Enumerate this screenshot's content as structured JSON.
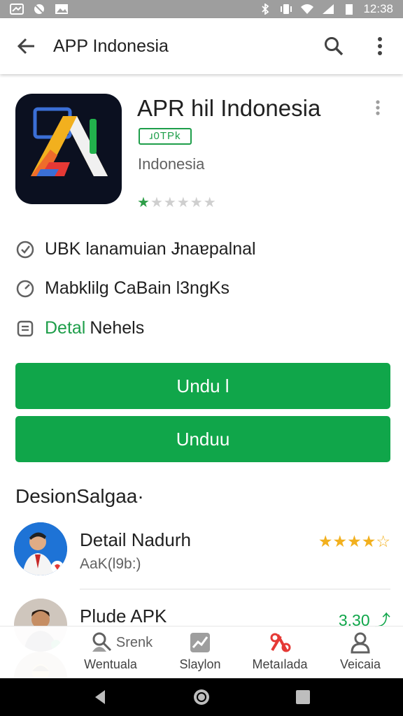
{
  "status_bar": {
    "time": "12:38"
  },
  "app_bar": {
    "title": "APP Indonesia"
  },
  "app": {
    "name": "APR hil Indonesia",
    "badge": "ɹ0TPk",
    "developer": "Indonesia",
    "rating_stars": 1,
    "rating_max": 5
  },
  "info_rows": [
    {
      "icon": "check-circle-icon",
      "accent": "",
      "text": "UBK Ɩanamuian Ɉnaɐpalnal"
    },
    {
      "icon": "speed-icon",
      "accent": "",
      "text": "Mabklilg CaBain Ɩ3ngKs"
    },
    {
      "icon": "doc-icon",
      "accent": "Detal",
      "text": "Nehels"
    }
  ],
  "buttons": {
    "primary": "Undu l",
    "secondary": "Unduu"
  },
  "section_title": "DesionSalgaa·",
  "list": [
    {
      "title": "Detail Nadurh",
      "subtitle": "AaK(Ɩ9b:)",
      "rating": "★★★★☆"
    },
    {
      "title": "Plude APK",
      "subtitle": "",
      "rating": "3.30 ⤴"
    }
  ],
  "bottom_nav": [
    {
      "icon": "search-person-icon",
      "label": "Wentuala",
      "extra": "Srenk"
    },
    {
      "icon": "chart-icon",
      "label": "Slaylon",
      "extra": ""
    },
    {
      "icon": "tools-icon",
      "label": "Metaılada",
      "extra": ""
    },
    {
      "icon": "person-icon",
      "label": "Veicaia",
      "extra": ""
    }
  ],
  "colors": {
    "accent": "#10a64a",
    "star_gold": "#f2b01e",
    "status_bar": "#9e9e9e"
  }
}
